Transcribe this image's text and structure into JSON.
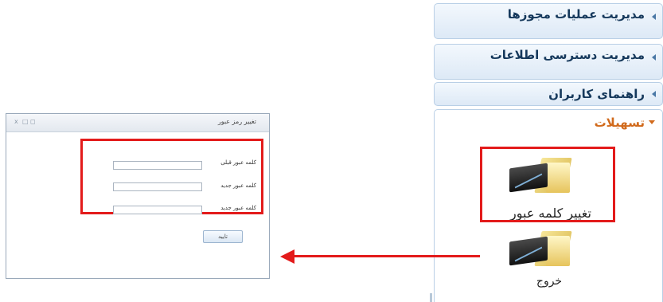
{
  "menu": {
    "items": [
      {
        "label": "مدیریت عملیات مجوزها"
      },
      {
        "label": "مدیریت دسترسی اطلاعات"
      },
      {
        "label": "راهنمای کاربران"
      }
    ],
    "open_section": {
      "label": "تسهیلات",
      "tools": [
        {
          "label": "تغییر کلمه عبور",
          "icon": "folder-monitor-icon"
        },
        {
          "label": "خروج",
          "icon": "folder-monitor-icon"
        }
      ]
    }
  },
  "dialog": {
    "title": "تغییر رمز عبور",
    "controls": [
      "x",
      "□",
      "◻"
    ],
    "fields": [
      {
        "label": "کلمه عبور قبلی",
        "value": ""
      },
      {
        "label": "کلمه عبور جدید",
        "value": ""
      },
      {
        "label": "کلمه عبور جدید",
        "value": ""
      }
    ],
    "ok_label": "تایید"
  },
  "colors": {
    "highlight": "#e31b1b",
    "menu_text": "#16395c",
    "section_header": "#d16a1c"
  }
}
